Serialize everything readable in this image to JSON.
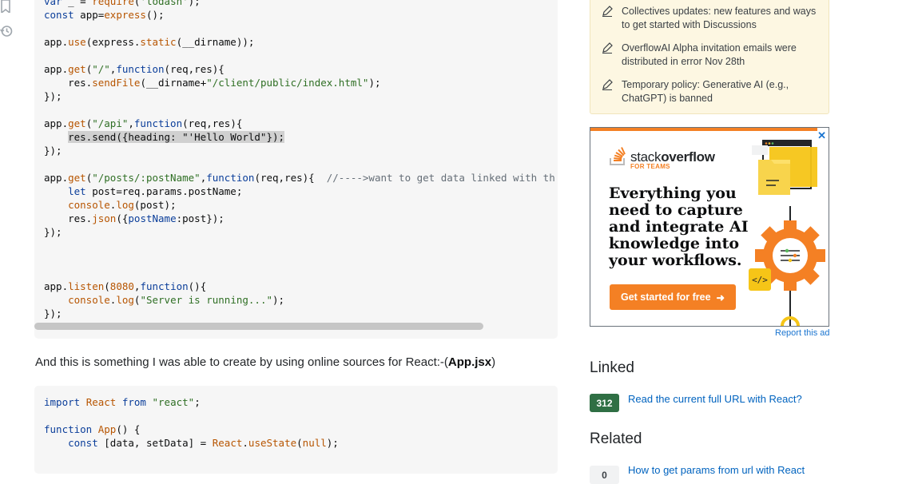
{
  "rail": {
    "icons": [
      "bookmark-icon",
      "history-icon"
    ]
  },
  "code1": {
    "lines": [
      [
        {
          "t": "var",
          "c": "kw"
        },
        {
          "t": " _ = "
        },
        {
          "t": "require",
          "c": "fn"
        },
        {
          "t": "("
        },
        {
          "t": "'lodash'",
          "c": "str"
        },
        {
          "t": ");"
        }
      ],
      [
        {
          "t": "const",
          "c": "kw"
        },
        {
          "t": " app="
        },
        {
          "t": "express",
          "c": "fn"
        },
        {
          "t": "();"
        }
      ],
      [],
      [
        {
          "t": "app."
        },
        {
          "t": "use",
          "c": "fn"
        },
        {
          "t": "(express."
        },
        {
          "t": "static",
          "c": "fn"
        },
        {
          "t": "(__dirname));"
        }
      ],
      [],
      [
        {
          "t": "app."
        },
        {
          "t": "get",
          "c": "fn"
        },
        {
          "t": "("
        },
        {
          "t": "\"/\"",
          "c": "str"
        },
        {
          "t": ","
        },
        {
          "t": "function",
          "c": "kw"
        },
        {
          "t": "(req,res){"
        }
      ],
      [
        {
          "t": "    res."
        },
        {
          "t": "sendFile",
          "c": "fn"
        },
        {
          "t": "(__dirname+"
        },
        {
          "t": "\"/client/public/index.html\"",
          "c": "str"
        },
        {
          "t": ");"
        }
      ],
      [
        {
          "t": "});"
        }
      ],
      [],
      [
        {
          "t": "app."
        },
        {
          "t": "get",
          "c": "fn"
        },
        {
          "t": "("
        },
        {
          "t": "\"/api\"",
          "c": "str"
        },
        {
          "t": ","
        },
        {
          "t": "function",
          "c": "kw"
        },
        {
          "t": "(req,res){"
        }
      ],
      [
        {
          "t": "    "
        },
        {
          "t": "res.send({heading: \"'Hello World\"});",
          "c": "hl"
        }
      ],
      [
        {
          "t": "});"
        }
      ],
      [],
      [
        {
          "t": "app."
        },
        {
          "t": "get",
          "c": "fn"
        },
        {
          "t": "("
        },
        {
          "t": "\"/posts/:postName\"",
          "c": "str"
        },
        {
          "t": ","
        },
        {
          "t": "function",
          "c": "kw"
        },
        {
          "t": "(req,res){  "
        },
        {
          "t": "//---->want to get data linked with th",
          "c": "cm"
        }
      ],
      [
        {
          "t": "    "
        },
        {
          "t": "let",
          "c": "kw"
        },
        {
          "t": " post=req.params.postName;"
        }
      ],
      [
        {
          "t": "    "
        },
        {
          "t": "console",
          "c": "fn"
        },
        {
          "t": "."
        },
        {
          "t": "log",
          "c": "fn"
        },
        {
          "t": "(post);"
        }
      ],
      [
        {
          "t": "    res."
        },
        {
          "t": "json",
          "c": "fn"
        },
        {
          "t": "({"
        },
        {
          "t": "postName",
          "c": "kw"
        },
        {
          "t": ":post});"
        }
      ],
      [
        {
          "t": "});"
        }
      ],
      [],
      [],
      [],
      [
        {
          "t": "app."
        },
        {
          "t": "listen",
          "c": "fn"
        },
        {
          "t": "("
        },
        {
          "t": "8080",
          "c": "fn"
        },
        {
          "t": ","
        },
        {
          "t": "function",
          "c": "kw"
        },
        {
          "t": "(){"
        }
      ],
      [
        {
          "t": "    "
        },
        {
          "t": "console",
          "c": "fn"
        },
        {
          "t": "."
        },
        {
          "t": "log",
          "c": "fn"
        },
        {
          "t": "("
        },
        {
          "t": "\"Server is running...\"",
          "c": "str"
        },
        {
          "t": ");"
        }
      ],
      [
        {
          "t": "});"
        }
      ]
    ]
  },
  "paragraph": {
    "text": "And this is something I was able to create by using online sources for React:-(",
    "bold": "App.jsx",
    "suffix": ")"
  },
  "code2": {
    "lines": [
      [
        {
          "t": "import",
          "c": "kw"
        },
        {
          "t": " "
        },
        {
          "t": "React",
          "c": "fn"
        },
        {
          "t": " "
        },
        {
          "t": "from",
          "c": "kw"
        },
        {
          "t": " "
        },
        {
          "t": "\"react\"",
          "c": "str"
        },
        {
          "t": ";"
        }
      ],
      [],
      [
        {
          "t": "function",
          "c": "kw"
        },
        {
          "t": " "
        },
        {
          "t": "App",
          "c": "fn"
        },
        {
          "t": "() {"
        }
      ],
      [
        {
          "t": "    "
        },
        {
          "t": "const",
          "c": "kw"
        },
        {
          "t": " [data, setData] = "
        },
        {
          "t": "React",
          "c": "fn"
        },
        {
          "t": "."
        },
        {
          "t": "useState",
          "c": "fn"
        },
        {
          "t": "("
        },
        {
          "t": "null",
          "c": "fn"
        },
        {
          "t": ");"
        }
      ]
    ]
  },
  "blog": {
    "items": [
      {
        "text": "Collectives updates: new features and ways to get started with Discussions"
      },
      {
        "text": "OverflowAI Alpha invitation emails were distributed in error Nov 28th"
      },
      {
        "text": "Temporary policy: Generative AI (e.g., ChatGPT) is banned"
      }
    ]
  },
  "ad": {
    "brand_light": "stack",
    "brand_bold": "overflow",
    "teams": "FOR TEAMS",
    "headline": "Everything you need to capture and integrate AI knowledge into your workflows.",
    "cta": "Get started for free",
    "report": "Report this ad",
    "close": "✕"
  },
  "linked": {
    "heading": "Linked",
    "items": [
      {
        "score": "312",
        "title": "Read the current full URL with React?"
      }
    ]
  },
  "related": {
    "heading": "Related",
    "items": [
      {
        "score": "0",
        "title": "How to get params from url with React"
      }
    ]
  },
  "colors": {
    "accent": "#f48024",
    "link": "#0063bf",
    "answered_badge": "#2f6f44"
  }
}
